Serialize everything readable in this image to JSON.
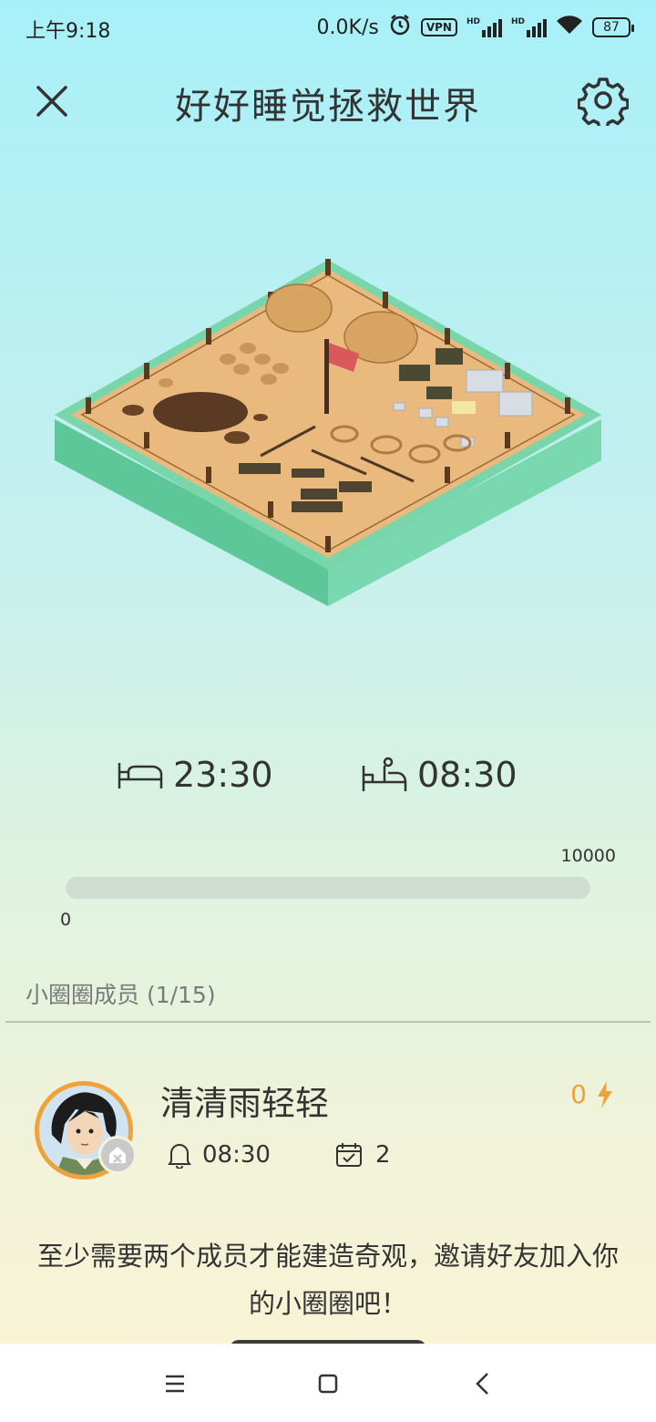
{
  "status_bar": {
    "time": "上午9:18",
    "network_speed": "0.0K/s",
    "vpn": "VPN",
    "hd1": "HD",
    "hd2": "HD",
    "battery": "87"
  },
  "header": {
    "title": "好好睡觉拯救世界",
    "close_icon": "close-icon",
    "settings_icon": "gear-icon"
  },
  "scene": {
    "icon": "construction-site-island"
  },
  "sleep": {
    "bedtime": "23:30",
    "wake_time": "08:30",
    "bed_icon": "bed-icon",
    "wake_icon": "wake-icon"
  },
  "progress": {
    "max_label": "10000",
    "min_label": "0",
    "value": 0
  },
  "members": {
    "title": "小圈圈成员 (1/15)",
    "list": [
      {
        "name": "清清雨轻轻",
        "energy": "0",
        "alarm": "08:30",
        "days": "2"
      }
    ]
  },
  "invite": {
    "text": "至少需要两个成员才能建造奇观，邀请好友加入你的小圈圈吧！"
  },
  "colors": {
    "accent": "#f0a23a",
    "progress_track": "#cfdcd2",
    "island_top": "#e9b97e",
    "island_side": "#6fd3a6"
  }
}
